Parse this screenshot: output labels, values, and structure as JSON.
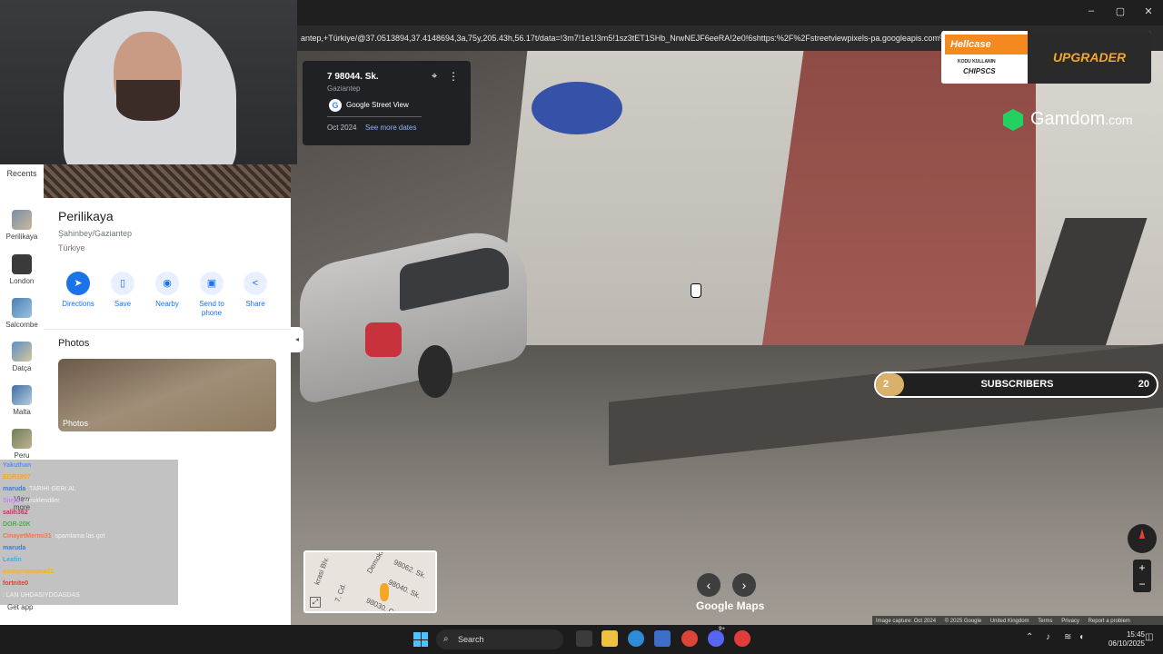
{
  "browser": {
    "url": "antep,+Türkiye/@37.0513894,37.4148694,3a,75y,205.43h,56.17t/data=!3m7!1e1!3m5!1sz3tET1SHb_NrwNEJF6eeRA!2e0!6shttps:%2F%2Fstreetviewpixels-pa.googleapis.com%"
  },
  "infocard": {
    "title": "7 98044. Sk.",
    "subtitle": "Gaziantep",
    "brand": "Google Street View",
    "date": "Oct 2024",
    "more_dates": "See more dates"
  },
  "sidebar": {
    "recents_label": "Recents",
    "items": [
      {
        "label": "Perilikaya"
      },
      {
        "label": "London"
      },
      {
        "label": "Salcombe"
      },
      {
        "label": "Datça"
      },
      {
        "label": "Malta"
      },
      {
        "label": "Peru"
      }
    ],
    "view_more": "View more",
    "get_app": "Get app"
  },
  "place": {
    "name": "Perilikaya",
    "address_line1": "Şahinbey/Gaziantep",
    "address_line2": "Türkiye",
    "actions": [
      {
        "label": "Directions",
        "icon": "directions-icon"
      },
      {
        "label": "Save",
        "icon": "bookmark-icon"
      },
      {
        "label": "Nearby",
        "icon": "nearby-icon"
      },
      {
        "label": "Send to phone",
        "icon": "phone-icon"
      },
      {
        "label": "Share",
        "icon": "share-icon"
      }
    ],
    "photos_heading": "Photos",
    "photos_label": "Photos"
  },
  "chat": [
    {
      "user": "Yakuthan",
      "msg": "",
      "color": "#5b8cff"
    },
    {
      "user": "EGR1907",
      "msg": "",
      "color": "#f5a623"
    },
    {
      "user": "maruda",
      "msg": ": TARIHI GERI AL",
      "color": "#3a7bd5"
    },
    {
      "user": "Sinyo",
      "msg": ": suruklendiler",
      "color": "#c77dff"
    },
    {
      "user": "salih362",
      "msg": "",
      "color": "#e91e63"
    },
    {
      "user": "DOR-20K",
      "msg": "",
      "color": "#4caf50"
    },
    {
      "user": "CinayetMermi31",
      "msg": ": spamlama las got",
      "color": "#ff7043"
    },
    {
      "user": "maruda",
      "msg": "",
      "color": "#3a7bd5"
    },
    {
      "user": "Leafin",
      "msg": "",
      "color": "#29b6f6"
    },
    {
      "user": "essoymanama31",
      "msg": "",
      "color": "#ffb300"
    },
    {
      "user": "fortnite0",
      "msg": "",
      "color": "#e53935"
    },
    {
      "user": "",
      "msg": ": LAN UHDASIYDGASDAS",
      "color": "#90caf9"
    }
  ],
  "ads": {
    "brand": "Hellcase",
    "code_line1": "KODU KULLANIN",
    "code_line2": "CHIPSCS",
    "cta": "UPGRADER",
    "sponsor": "Gamdom",
    "sponsor_suffix": ".com"
  },
  "subscribers": {
    "current": "2",
    "label": "SUBSCRIBERS",
    "goal": "20",
    "progress": 0.1
  },
  "map": {
    "watermark": "Google Maps",
    "minimap_roads": [
      "Demokra",
      "98062. Sk.",
      "98040. Sk.",
      "98030. C",
      "krasi Blv.",
      "7. Cd."
    ],
    "footer": [
      "Image capture: Oct 2024",
      "© 2025 Google",
      "United Kingdom",
      "Terms",
      "Privacy",
      "Report a problem"
    ]
  },
  "taskbar": {
    "search_placeholder": "Search",
    "time": "15:45",
    "date": "06/10/2025",
    "badge": "9+"
  }
}
